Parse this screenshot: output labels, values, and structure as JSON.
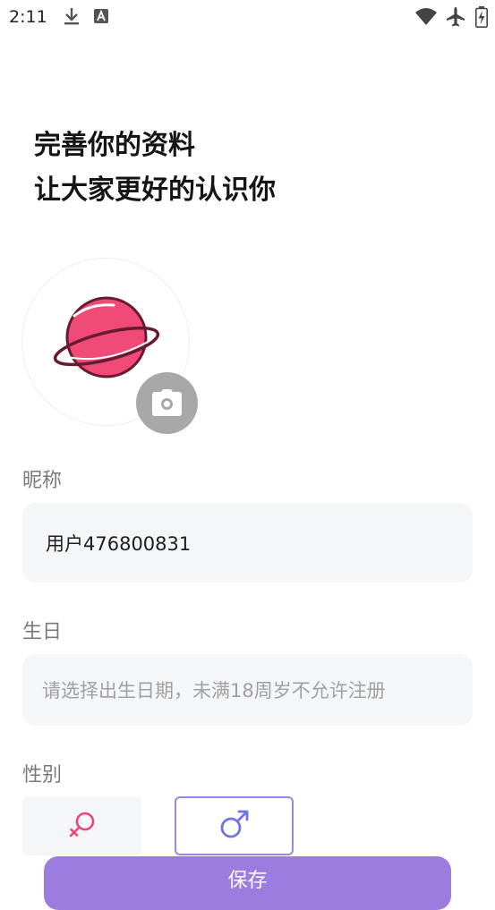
{
  "status_bar": {
    "time": "2:11",
    "left_icons": [
      "download-icon",
      "app-notification-icon"
    ],
    "right_icons": [
      "wifi-icon",
      "airplane-mode-icon",
      "battery-charging-icon"
    ]
  },
  "header": {
    "line1": "完善你的资料",
    "line2": "让大家更好的认识你"
  },
  "avatar": {
    "icon": "planet-icon",
    "camera_icon": "camera-icon"
  },
  "nickname": {
    "label": "昵称",
    "value": "用户476800831"
  },
  "birthday": {
    "label": "生日",
    "placeholder": "请选择出生日期，未满18周岁不允许注册"
  },
  "gender": {
    "label": "性别",
    "options": [
      {
        "icon": "female-symbol-icon",
        "color": "#e8457a",
        "selected": false
      },
      {
        "icon": "male-symbol-icon",
        "color": "#6d74e8",
        "selected": true
      }
    ]
  },
  "save": {
    "label": "保存"
  },
  "colors": {
    "accent": "#9d7ce0",
    "selected_border": "#9b87e6",
    "field_bg": "#f5f6f8",
    "planet": "#f04a78"
  }
}
